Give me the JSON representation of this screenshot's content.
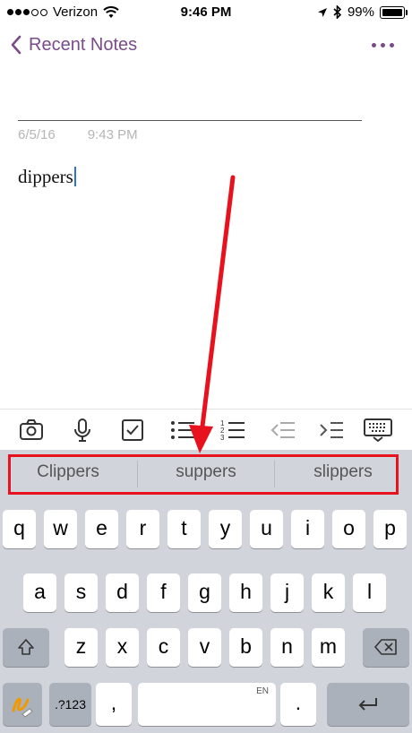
{
  "status_bar": {
    "carrier": "Verizon",
    "time": "9:46 PM",
    "battery": "99%"
  },
  "nav": {
    "back_label": "Recent Notes"
  },
  "note": {
    "date": "6/5/16",
    "time": "9:43 PM",
    "body": "dippers"
  },
  "toolbar": {
    "icons": [
      "camera-icon",
      "microphone-icon",
      "checkbox-icon",
      "bullet-list-icon",
      "numbered-list-icon",
      "outdent-icon",
      "indent-icon",
      "keyboard-dismiss-icon"
    ]
  },
  "suggestions": [
    "Clippers",
    "suppers",
    "slippers"
  ],
  "keyboard": {
    "row1": [
      "q",
      "w",
      "e",
      "r",
      "t",
      "y",
      "u",
      "i",
      "o",
      "p"
    ],
    "row2": [
      "a",
      "s",
      "d",
      "f",
      "g",
      "h",
      "j",
      "k",
      "l"
    ],
    "row3": [
      "z",
      "x",
      "c",
      "v",
      "b",
      "n",
      "m"
    ],
    "numbers_label": ".?123",
    "comma": ",",
    "period": ".",
    "space_lang": "EN"
  },
  "colors": {
    "accent": "#7a4a8b",
    "highlight": "#e8121e",
    "caret": "#2f6fd9"
  }
}
